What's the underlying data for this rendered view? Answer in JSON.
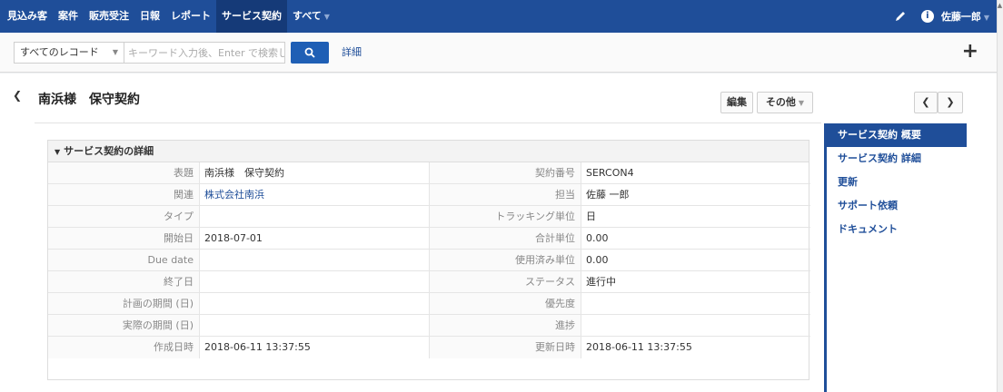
{
  "nav": {
    "items": [
      {
        "label": "見込み客"
      },
      {
        "label": "案件"
      },
      {
        "label": "販売受注"
      },
      {
        "label": "日報"
      },
      {
        "label": "レポート"
      },
      {
        "label": "サービス契約",
        "active": true
      },
      {
        "label": "すべて",
        "has_dropdown": true
      }
    ],
    "user": "佐藤一郎",
    "icons": [
      "pencil-icon",
      "info-icon",
      "chevron-down-icon"
    ]
  },
  "search": {
    "record_select": "すべてのレコード",
    "placeholder": "キーワード入力後、Enter で検索しま",
    "detail_label": "詳細"
  },
  "page": {
    "title": "南浜様　保守契約",
    "edit_label": "編集",
    "other_label": "その他"
  },
  "side_nav": [
    {
      "label": "サービス契約 概要",
      "active": true
    },
    {
      "label": "サービス契約 詳細"
    },
    {
      "label": "更新"
    },
    {
      "label": "サポート依頼"
    },
    {
      "label": "ドキュメント"
    }
  ],
  "panel": {
    "header": "サービス契約の詳細",
    "rows": [
      {
        "l1": "表題",
        "v1": "南浜様　保守契約",
        "l2": "契約番号",
        "v2": "SERCON4"
      },
      {
        "l1": "関連",
        "v1": "株式会社南浜",
        "v1_link": true,
        "l2": "担当",
        "v2": "佐藤 一郎"
      },
      {
        "l1": "タイプ",
        "v1": "",
        "l2": "トラッキング単位",
        "v2": "日"
      },
      {
        "l1": "開始日",
        "v1": "2018-07-01",
        "l2": "合計単位",
        "v2": "0.00"
      },
      {
        "l1": "Due date",
        "v1": "",
        "l2": "使用済み単位",
        "v2": "0.00"
      },
      {
        "l1": "終了日",
        "v1": "",
        "l2": "ステータス",
        "v2": "進行中"
      },
      {
        "l1": "計画の期間 (日)",
        "v1": "",
        "l2": "優先度",
        "v2": ""
      },
      {
        "l1": "実際の期間 (日)",
        "v1": "",
        "l2": "進捗",
        "v2": ""
      },
      {
        "l1": "作成日時",
        "v1": "2018-06-11 13:37:55",
        "l2": "更新日時",
        "v2": "2018-06-11 13:37:55"
      }
    ]
  }
}
